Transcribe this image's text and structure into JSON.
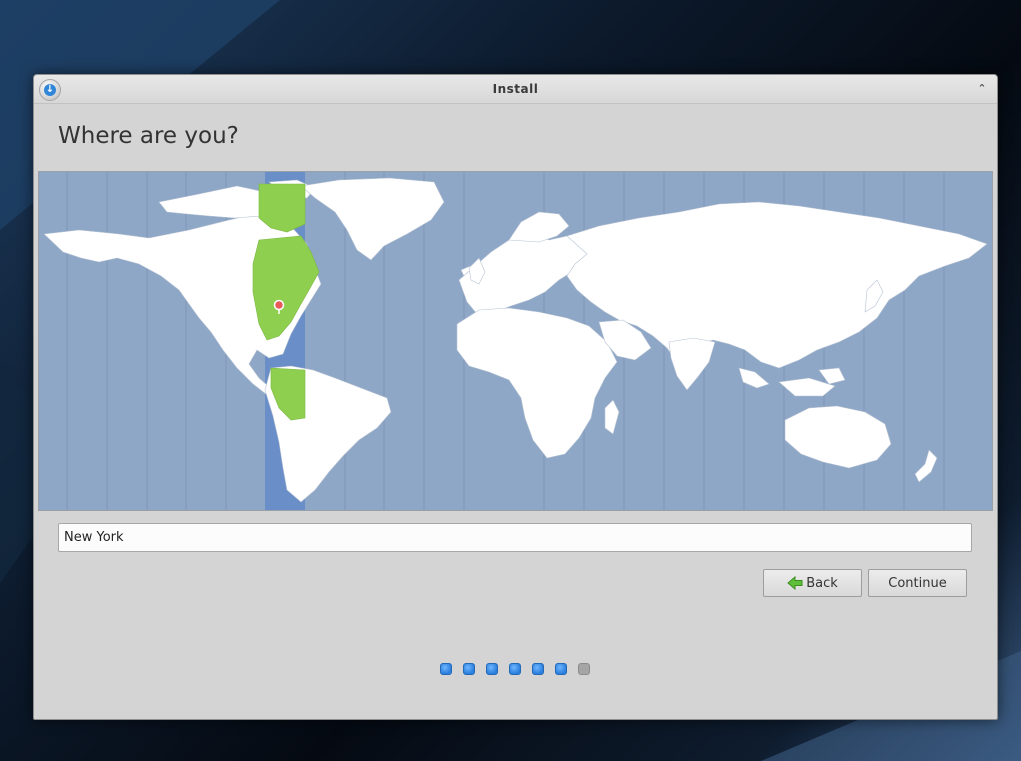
{
  "window": {
    "title": "Install",
    "app_icon": "installer-download-icon",
    "collapse_icon": "chevron-up-icon",
    "collapse_glyph": "⌃"
  },
  "page": {
    "heading": "Where are you?"
  },
  "location": {
    "value": "New York",
    "placeholder": ""
  },
  "map": {
    "selected_timezone_highlight": "#8fcf4f",
    "selected_band": "#6a8ec7",
    "ocean": "#8fa7c6",
    "land": "#ffffff",
    "marker_color": "#e85a5a"
  },
  "buttons": {
    "back_label": "Back",
    "back_icon": "green-left-arrow-icon",
    "continue_label": "Continue"
  },
  "progress": {
    "steps": [
      "done",
      "done",
      "done",
      "done",
      "done",
      "done",
      "todo"
    ]
  }
}
